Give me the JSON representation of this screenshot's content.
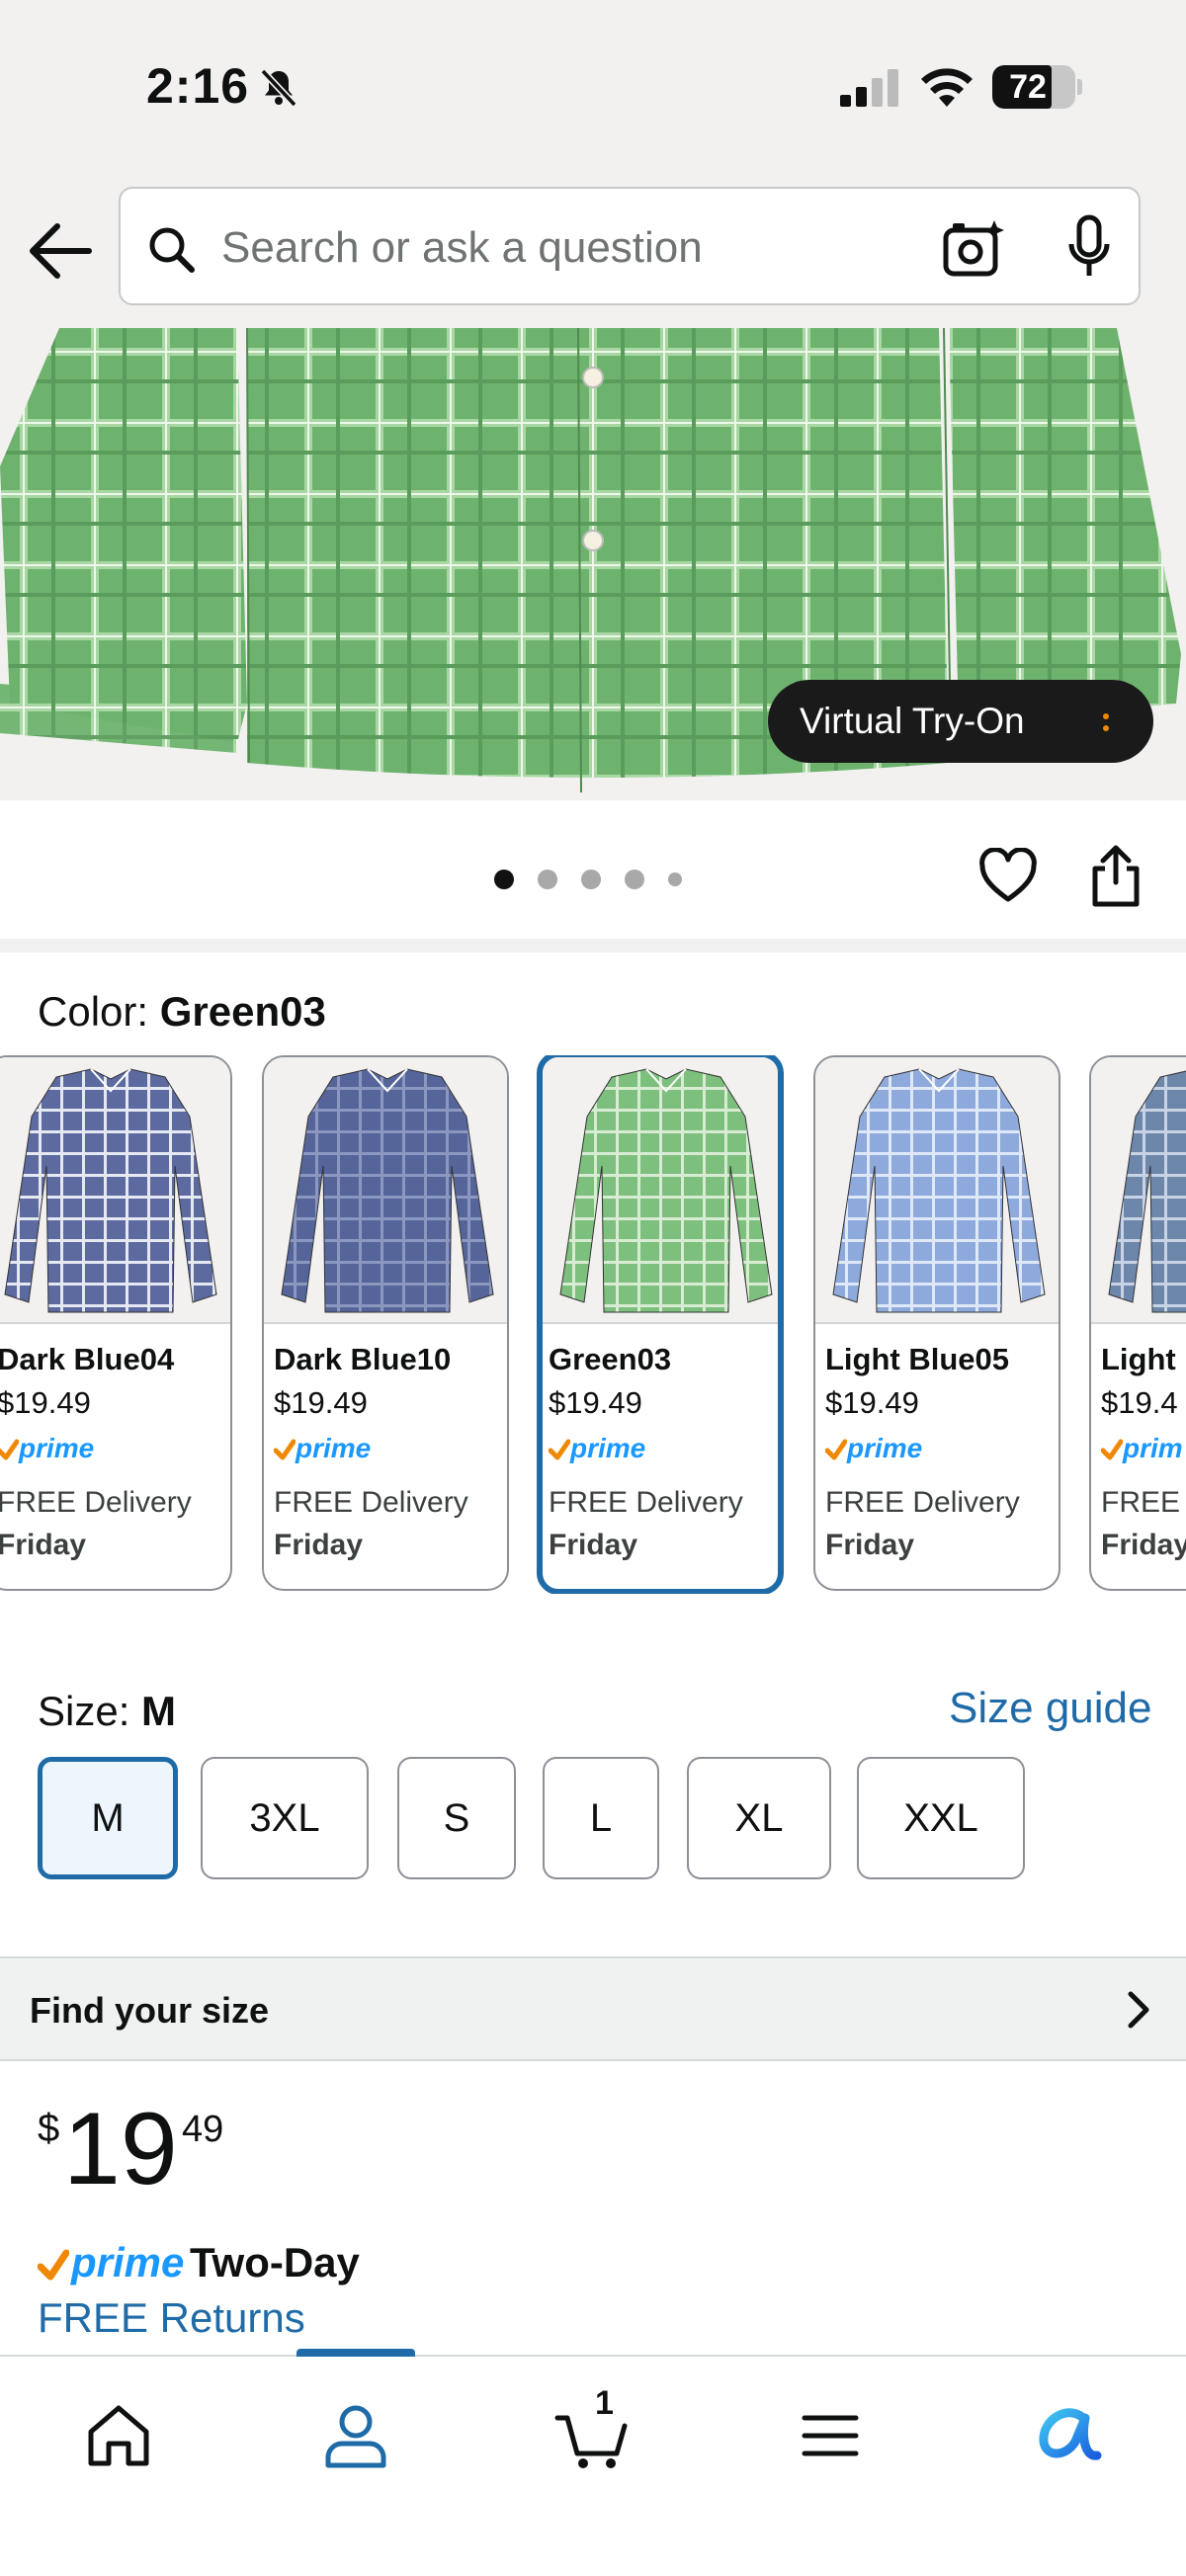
{
  "status_bar": {
    "time": "2:16",
    "battery": "72",
    "battery_level": 0.72
  },
  "search": {
    "placeholder": "Search or ask a question"
  },
  "product_image": {
    "try_on_label": "Virtual Try-On",
    "image_count": 5,
    "active_image": 1
  },
  "color": {
    "label": "Color:",
    "selected": "Green03",
    "swatches": [
      {
        "name": "Dark Blue04",
        "price": "$19.49",
        "prime": "prime",
        "delivery": "FREE Delivery",
        "day": "Friday",
        "shirt_color": "#5c6aa0",
        "check_color": "#e6e8f2",
        "selected": false
      },
      {
        "name": "Dark Blue10",
        "price": "$19.49",
        "prime": "prime",
        "delivery": "FREE Delivery",
        "day": "Friday",
        "shirt_color": "#55659a",
        "check_color": "#8c97c0",
        "selected": false
      },
      {
        "name": "Green03",
        "price": "$19.49",
        "prime": "prime",
        "delivery": "FREE Delivery",
        "day": "Friday",
        "shirt_color": "#7dbf7c",
        "check_color": "#d8ecd3",
        "selected": true
      },
      {
        "name": "Light Blue05",
        "price": "$19.49",
        "prime": "prime",
        "delivery": "FREE Delivery",
        "day": "Friday",
        "shirt_color": "#8ea9dc",
        "check_color": "#dfe8f7",
        "selected": false
      },
      {
        "name": "Light",
        "price": "$19.4",
        "prime": "prim",
        "delivery": "FREE",
        "day": "Friday",
        "shirt_color": "#6d87ab",
        "check_color": "#c8d4e5",
        "selected": false
      }
    ]
  },
  "size": {
    "label": "Size:",
    "selected": "M",
    "guide_label": "Size guide",
    "options": [
      "M",
      "3XL",
      "S",
      "L",
      "XL",
      "XXL"
    ]
  },
  "find_size": {
    "label": "Find your size"
  },
  "price": {
    "symbol": "$",
    "whole": "19",
    "fraction": "49"
  },
  "shipping": {
    "prime": "prime",
    "speed": "Two-Day",
    "returns": "FREE Returns"
  },
  "nav": {
    "cart_count": "1",
    "items": [
      "home-icon",
      "account-icon",
      "cart-icon",
      "menu-icon",
      "rufus-icon"
    ]
  },
  "colors": {
    "accent": "#1f6ba7",
    "prime_blue": "#1a98ff",
    "prime_check": "#f08804",
    "shirt_green": "#6db36e"
  }
}
